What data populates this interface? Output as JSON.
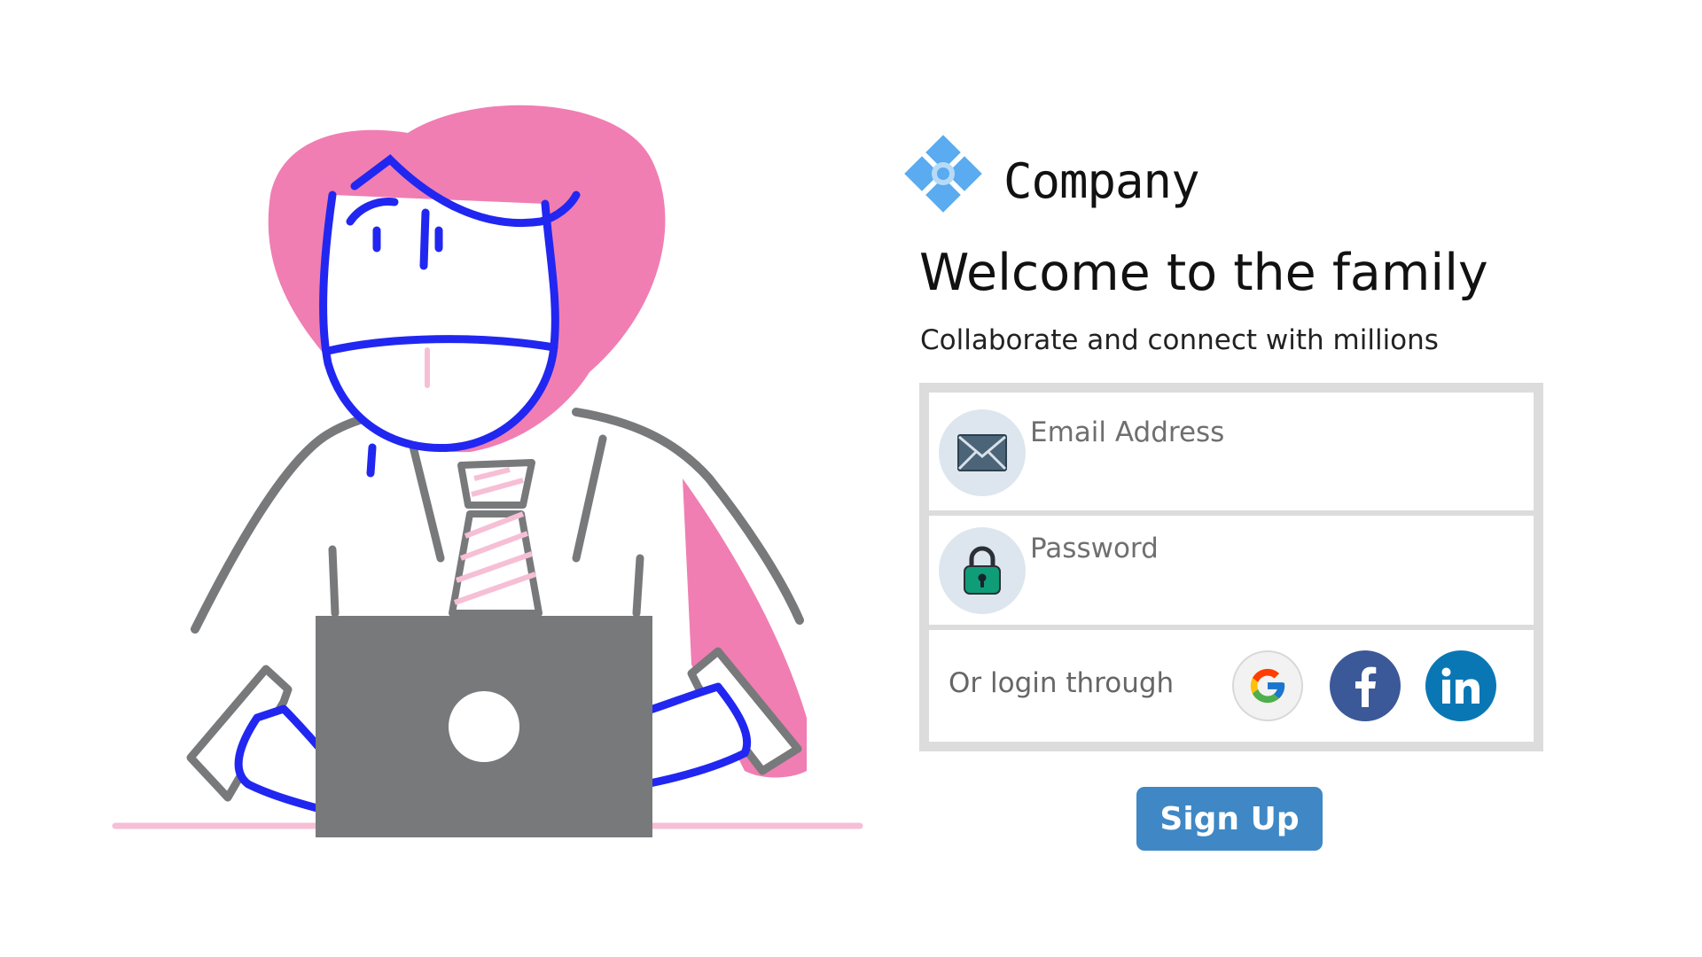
{
  "brand": {
    "name": "Company",
    "logo_icon": "diamond-flower-logo-icon",
    "logo_color": "#5aabef"
  },
  "hero": {
    "title": "Welcome to the family",
    "subtitle": "Collaborate and connect with millions"
  },
  "form": {
    "email": {
      "placeholder": "Email Address",
      "value": "",
      "icon": "envelope-icon"
    },
    "password": {
      "placeholder": "Password",
      "value": "",
      "icon": "padlock-icon"
    },
    "social": {
      "label": "Or login through",
      "providers": [
        {
          "name": "google",
          "icon": "google-icon",
          "color": "#4285f4"
        },
        {
          "name": "facebook",
          "icon": "facebook-icon",
          "color": "#3b5998"
        },
        {
          "name": "linkedin",
          "icon": "linkedin-icon",
          "color": "#0a77b5"
        }
      ]
    },
    "submit_label": "Sign Up"
  },
  "illustration": {
    "subject": "masked-person-at-laptop-illustration",
    "colors": {
      "hair": "#f07eb2",
      "outline": "#2127f0",
      "clothes_outline": "#78797b",
      "laptop": "#78797b",
      "tie_stripe": "#f6bfd6",
      "desk": "#f6bfd6"
    }
  },
  "colors": {
    "accent": "#3f88c5",
    "border": "#dcdcdc",
    "icon_bg": "#dde6ee"
  }
}
